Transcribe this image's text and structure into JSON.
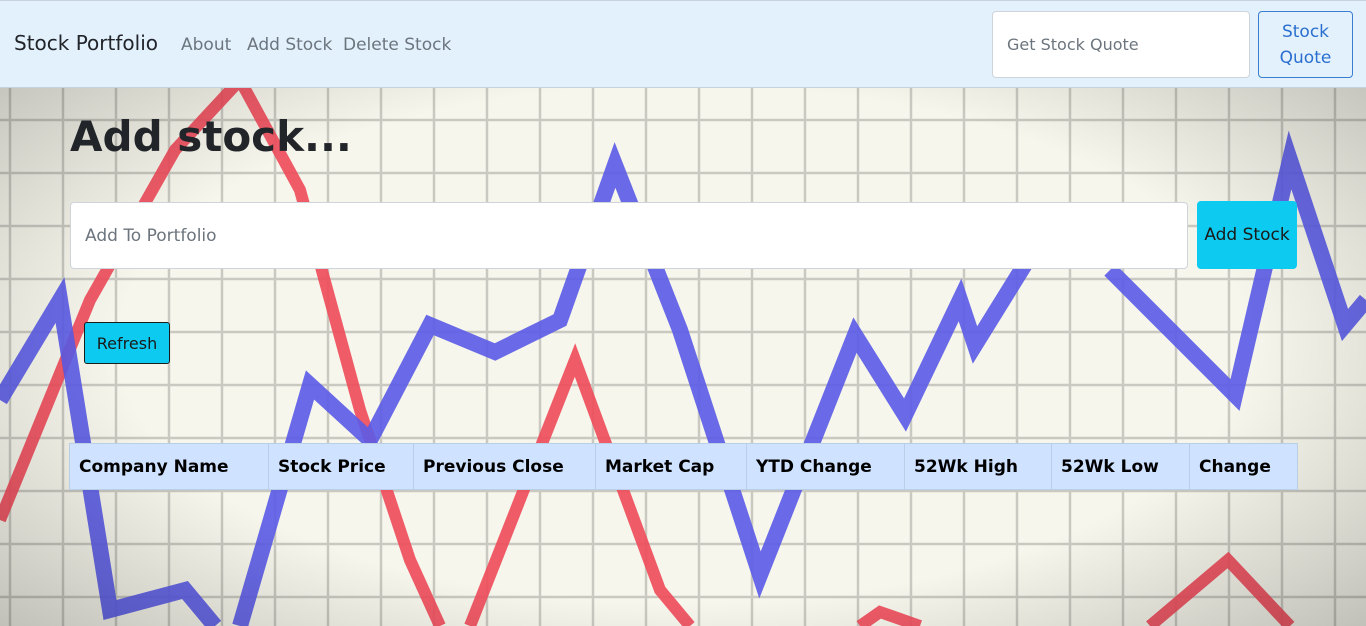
{
  "navbar": {
    "brand": "Stock Portfolio",
    "links": [
      "About",
      "Add Stock",
      "Delete Stock"
    ],
    "quote_placeholder": "Get Stock Quote",
    "quote_button": "Stock Quote"
  },
  "main": {
    "title": "Add stock...",
    "add_placeholder": "Add To Portfolio",
    "add_button": "Add Stock",
    "refresh_button": "Refresh"
  },
  "table": {
    "headers": [
      "Company Name",
      "Stock Price",
      "Previous Close",
      "Market Cap",
      "YTD Change",
      "52Wk High",
      "52Wk Low",
      "Change"
    ]
  },
  "colors": {
    "navbar_bg": "#e3f1fd",
    "accent_button": "#0dcaf0",
    "outline_button": "#2a6fcf",
    "table_header_bg": "#cfe2ff",
    "chart_blue": "#5b5be8",
    "chart_red": "#f04a5a"
  }
}
